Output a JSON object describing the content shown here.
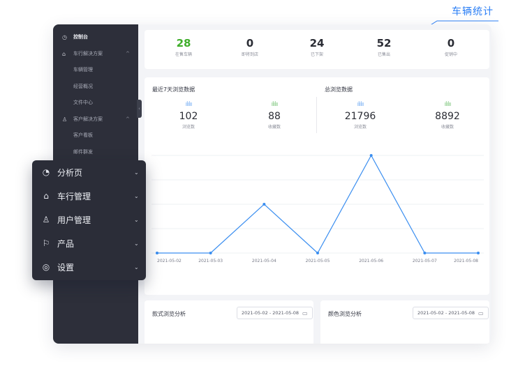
{
  "callout": {
    "label": "车辆统计"
  },
  "sidebar": {
    "items": [
      {
        "icon": "clock-icon",
        "glyph": "◷",
        "label": "控制台",
        "level": "head"
      },
      {
        "icon": "home-icon",
        "glyph": "⌂",
        "label": "车行解决方案",
        "level": "group",
        "chevron": "^"
      },
      {
        "label": "车辆管理",
        "level": "sub"
      },
      {
        "label": "经营概况",
        "level": "sub"
      },
      {
        "label": "文件中心",
        "level": "sub"
      },
      {
        "icon": "user-icon",
        "glyph": "♙",
        "label": "客户解决方案",
        "level": "group",
        "chevron": "^"
      },
      {
        "label": "客户看板",
        "level": "sub"
      },
      {
        "label": "邮件群发",
        "level": "sub"
      }
    ],
    "collapse_glyph": "‹"
  },
  "stats": [
    {
      "value": "28",
      "label": "在售车辆",
      "highlight": true
    },
    {
      "value": "0",
      "label": "即将到店"
    },
    {
      "value": "24",
      "label": "已下架"
    },
    {
      "value": "52",
      "label": "已售出"
    },
    {
      "value": "0",
      "label": "促销中"
    }
  ],
  "browse": {
    "recent_title": "最近7天浏览数据",
    "total_title": "总浏览数据",
    "metrics": [
      {
        "value": "102",
        "caption": "浏览数",
        "bars": "ılılıı",
        "color": "blue"
      },
      {
        "value": "88",
        "caption": "收藏数",
        "bars": "ılılıı",
        "color": "green"
      },
      {
        "value": "21796",
        "caption": "浏览数",
        "bars": "ılılıı",
        "color": "blue"
      },
      {
        "value": "8892",
        "caption": "收藏数",
        "bars": "ılılıı",
        "color": "green"
      }
    ]
  },
  "chart_data": {
    "type": "line",
    "x": [
      "2021-05-02",
      "2021-05-03",
      "2021-05-04",
      "2021-05-05",
      "2021-05-06",
      "2021-05-07",
      "2021-05-08"
    ],
    "series": [
      {
        "values": [
          0,
          0,
          40,
          0,
          80,
          0,
          0
        ]
      }
    ],
    "ylim": [
      0,
      80
    ],
    "grid": true,
    "color": "#3a8ef0"
  },
  "panels": {
    "style_title": "款式浏览分析",
    "color_title": "颜色浏览分析",
    "date_range": "2021-05-02 - 2021-05-08"
  },
  "float_menu": {
    "items": [
      {
        "icon": "pie-chart-icon",
        "glyph": "◔",
        "label": "分析页"
      },
      {
        "icon": "home-icon",
        "glyph": "⌂",
        "label": "车行管理"
      },
      {
        "icon": "user-icon",
        "glyph": "♙",
        "label": "用户管理"
      },
      {
        "icon": "flag-icon",
        "glyph": "⚐",
        "label": "产品"
      },
      {
        "icon": "settings-icon",
        "glyph": "◎",
        "label": "设置"
      }
    ],
    "chevron": "⌄"
  }
}
